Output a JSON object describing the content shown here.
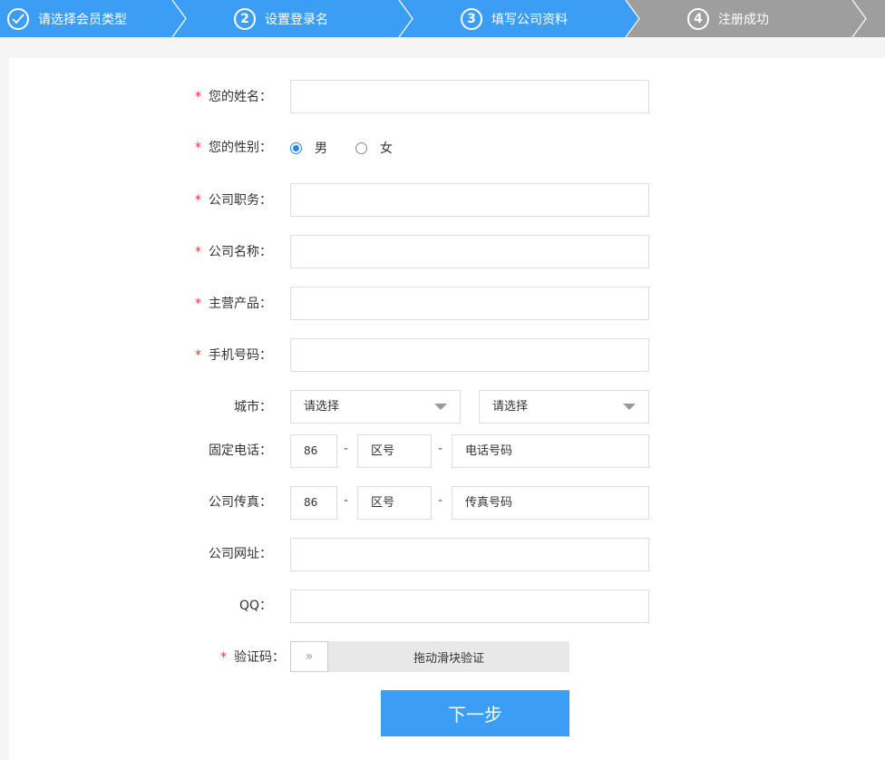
{
  "steps": [
    {
      "number": "",
      "label": "请选择会员类型",
      "icon": "check-icon"
    },
    {
      "number": "2",
      "label": "设置登录名"
    },
    {
      "number": "3",
      "label": "填写公司资料"
    },
    {
      "number": "4",
      "label": "注册成功"
    }
  ],
  "colors": {
    "step_done": "#3c9df5",
    "step_todo": "#9e9e9e",
    "required": "#e53935",
    "primary": "#3c9df5"
  },
  "form": {
    "required_mark": "*",
    "name_label": "您的姓名：",
    "name_value": "",
    "gender_label": "您的性别：",
    "gender_options": [
      "男",
      "女"
    ],
    "gender_selected": "男",
    "position_label": "公司职务：",
    "position_value": "",
    "company_label": "公司名称：",
    "company_value": "",
    "product_label": "主营产品：",
    "product_value": "",
    "mobile_label": "手机号码：",
    "mobile_value": "",
    "city_label": "城市：",
    "province_select": "请选择",
    "city_select": "请选择",
    "phone_label": "固定电话：",
    "phone_country": "86",
    "phone_area_placeholder": "区号",
    "phone_number_placeholder": "电话号码",
    "fax_label": "公司传真：",
    "fax_country": "86",
    "fax_area_placeholder": "区号",
    "fax_number_placeholder": "传真号码",
    "separator": "-",
    "website_label": "公司网址：",
    "website_value": "",
    "qq_label": "QQ：",
    "qq_value": "",
    "captcha_label": "验证码：",
    "slider_handle": "»",
    "slider_text": "拖动滑块验证",
    "next_button": "下一步"
  }
}
